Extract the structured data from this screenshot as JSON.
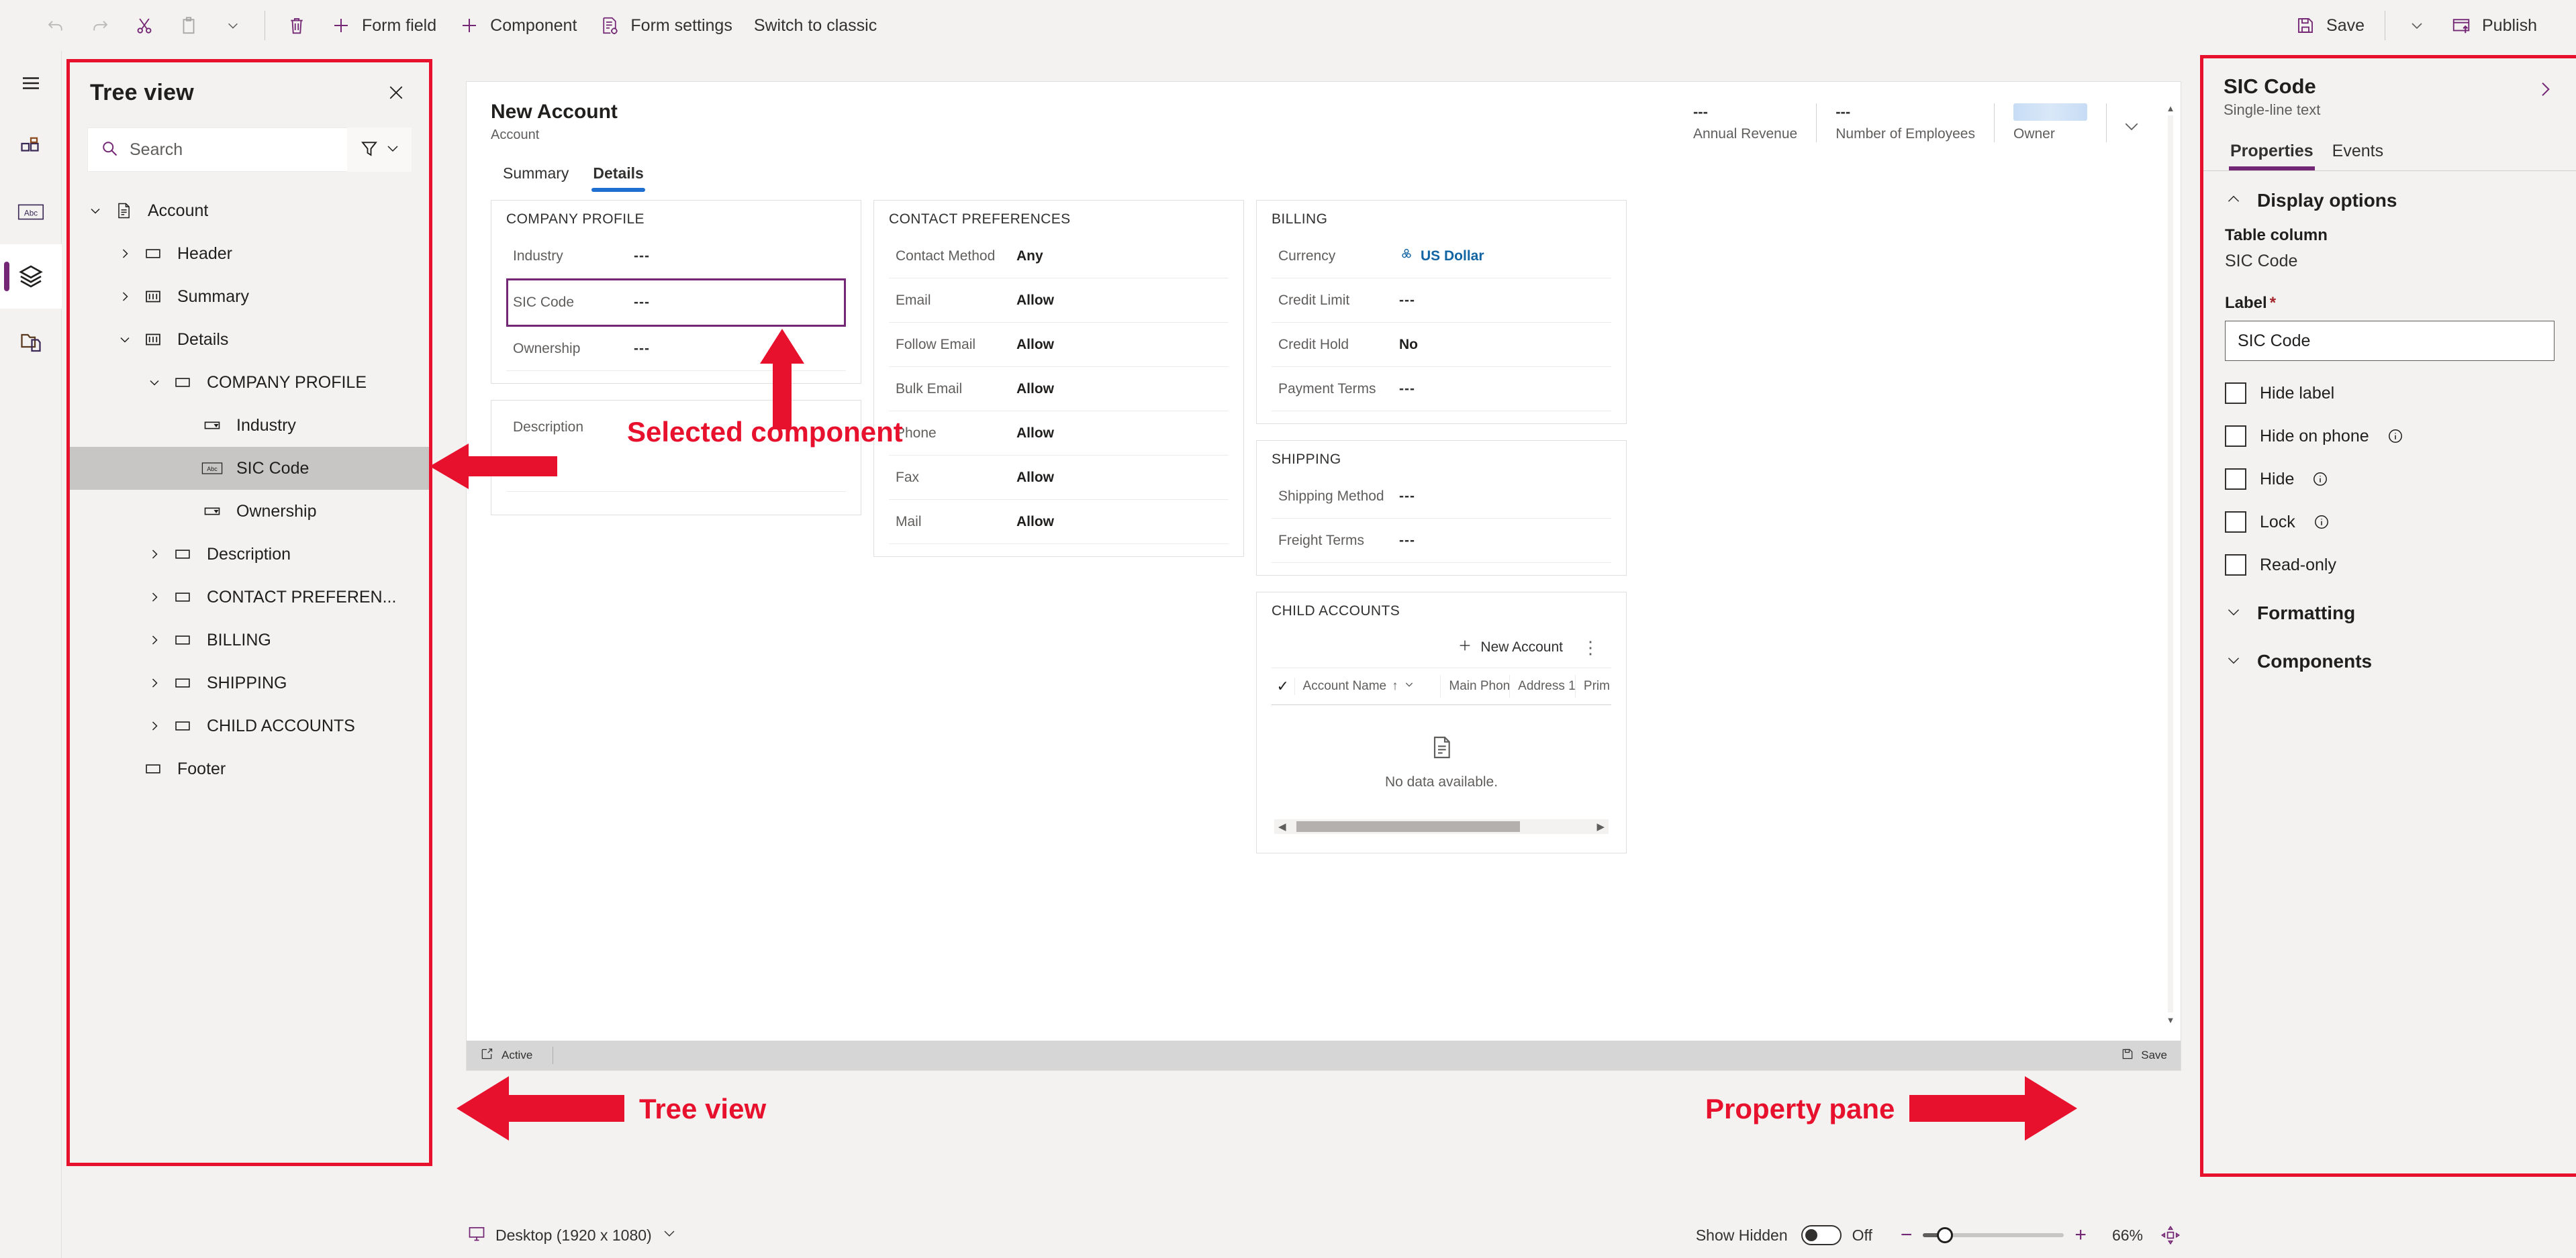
{
  "command_bar": {
    "left_buttons": [
      {
        "label": "",
        "icon": "undo-icon",
        "disabled": true
      },
      {
        "label": "",
        "icon": "redo-icon",
        "disabled": true
      },
      {
        "label": "",
        "icon": "cut-icon",
        "disabled": false
      },
      {
        "label": "",
        "icon": "paste-icon",
        "disabled": false
      },
      {
        "label": "",
        "icon": "chevron-down-icon",
        "disabled": false
      },
      {
        "label": "",
        "icon": "delete-icon",
        "disabled": false
      },
      {
        "label": "Form field",
        "icon": "plus-icon",
        "disabled": false
      },
      {
        "label": "Component",
        "icon": "plus-icon",
        "disabled": false
      },
      {
        "label": "Form settings",
        "icon": "form-settings-icon",
        "disabled": false
      },
      {
        "label": "Switch to classic",
        "icon": "",
        "disabled": false
      }
    ],
    "save_label": "Save",
    "publish_label": "Publish"
  },
  "rail": {
    "items": [
      {
        "name": "hamburger-menu-icon"
      },
      {
        "name": "components-icon"
      },
      {
        "name": "table-columns-icon"
      },
      {
        "name": "layers-icon"
      },
      {
        "name": "related-forms-icon"
      }
    ]
  },
  "tree_view": {
    "title": "Tree view",
    "search_placeholder": "Search",
    "search_value": "",
    "nodes": [
      {
        "label": "Account",
        "indent": 0,
        "chevron": "down",
        "icon": "document-icon",
        "selected": false
      },
      {
        "label": "Header",
        "indent": 1,
        "chevron": "right",
        "icon": "section-icon",
        "selected": false
      },
      {
        "label": "Summary",
        "indent": 1,
        "chevron": "right",
        "icon": "tab-icon",
        "selected": false
      },
      {
        "label": "Details",
        "indent": 1,
        "chevron": "down",
        "icon": "tab-icon",
        "selected": false
      },
      {
        "label": "COMPANY PROFILE",
        "indent": 2,
        "chevron": "down",
        "icon": "section-icon",
        "selected": false
      },
      {
        "label": "Industry",
        "indent": 3,
        "chevron": "none",
        "icon": "choice-icon",
        "selected": false
      },
      {
        "label": "SIC Code",
        "indent": 3,
        "chevron": "none",
        "icon": "text-abc-icon",
        "selected": true
      },
      {
        "label": "Ownership",
        "indent": 3,
        "chevron": "none",
        "icon": "choice-icon",
        "selected": false
      },
      {
        "label": "Description",
        "indent": 2,
        "chevron": "right",
        "icon": "section-icon",
        "selected": false
      },
      {
        "label": "CONTACT PREFEREN...",
        "indent": 2,
        "chevron": "right",
        "icon": "section-icon",
        "selected": false
      },
      {
        "label": "BILLING",
        "indent": 2,
        "chevron": "right",
        "icon": "section-icon",
        "selected": false
      },
      {
        "label": "SHIPPING",
        "indent": 2,
        "chevron": "right",
        "icon": "section-icon",
        "selected": false
      },
      {
        "label": "CHILD ACCOUNTS",
        "indent": 2,
        "chevron": "right",
        "icon": "section-icon",
        "selected": false
      },
      {
        "label": "Footer",
        "indent": 1,
        "chevron": "none",
        "icon": "section-icon",
        "selected": false
      }
    ]
  },
  "form": {
    "title": "New Account",
    "subtitle": "Account",
    "header_fields": [
      {
        "value": "---",
        "label": "Annual Revenue"
      },
      {
        "value": "---",
        "label": "Number of Employees"
      },
      {
        "value": "",
        "label": "Owner"
      }
    ],
    "tabs": [
      {
        "label": "Summary",
        "active": false
      },
      {
        "label": "Details",
        "active": true
      }
    ],
    "sections": {
      "company_profile": {
        "title": "COMPANY PROFILE",
        "rows": [
          {
            "label": "Industry",
            "value": "---",
            "selected": false
          },
          {
            "label": "SIC Code",
            "value": "---",
            "selected": true
          },
          {
            "label": "Ownership",
            "value": "---",
            "selected": false
          }
        ]
      },
      "description": {
        "label": "Description",
        "value": ""
      },
      "contact_preferences": {
        "title": "CONTACT PREFERENCES",
        "rows": [
          {
            "label": "Contact Method",
            "value": "Any"
          },
          {
            "label": "Email",
            "value": "Allow"
          },
          {
            "label": "Follow Email",
            "value": "Allow"
          },
          {
            "label": "Bulk Email",
            "value": "Allow"
          },
          {
            "label": "Phone",
            "value": "Allow"
          },
          {
            "label": "Fax",
            "value": "Allow"
          },
          {
            "label": "Mail",
            "value": "Allow"
          }
        ]
      },
      "billing": {
        "title": "BILLING",
        "rows": [
          {
            "label": "Currency",
            "value": "US Dollar",
            "link": true
          },
          {
            "label": "Credit Limit",
            "value": "---",
            "link": false
          },
          {
            "label": "Credit Hold",
            "value": "No",
            "link": false
          },
          {
            "label": "Payment Terms",
            "value": "---",
            "link": false
          }
        ]
      },
      "shipping": {
        "title": "SHIPPING",
        "rows": [
          {
            "label": "Shipping Method",
            "value": "---"
          },
          {
            "label": "Freight Terms",
            "value": "---"
          }
        ]
      },
      "child_accounts": {
        "title": "CHILD ACCOUNTS",
        "new_button": "New Account",
        "columns": [
          "Account Name",
          "Main Phone",
          "Address 1: ...",
          "Prim"
        ],
        "empty_text": "No data available."
      }
    },
    "footer": {
      "status": "Active",
      "save_label": "Save"
    }
  },
  "property_pane": {
    "title": "SIC Code",
    "subtitle": "Single-line text",
    "tabs": [
      {
        "label": "Properties",
        "active": true
      },
      {
        "label": "Events",
        "active": false
      }
    ],
    "groups": [
      {
        "label": "Display options",
        "expanded": true
      },
      {
        "label": "Formatting",
        "expanded": false
      },
      {
        "label": "Components",
        "expanded": false
      }
    ],
    "table_column_label": "Table column",
    "table_column_value": "SIC Code",
    "label_field_label": "Label",
    "label_field_value": "SIC Code",
    "checkboxes": [
      {
        "label": "Hide label",
        "checked": false,
        "info": false
      },
      {
        "label": "Hide on phone",
        "checked": false,
        "info": true
      },
      {
        "label": "Hide",
        "checked": false,
        "info": true
      },
      {
        "label": "Lock",
        "checked": false,
        "info": true
      },
      {
        "label": "Read-only",
        "checked": false,
        "info": false
      }
    ]
  },
  "bottom_bar": {
    "device_label": "Desktop (1920 x 1080)",
    "show_hidden_label": "Show Hidden",
    "show_hidden_state": "Off",
    "zoom_percent": "66%"
  },
  "annotations": [
    {
      "text": "Selected component"
    },
    {
      "text": "Tree view"
    },
    {
      "text": "Property pane"
    }
  ],
  "colors": {
    "accent_purple": "#742774",
    "annotation_red": "#e8112d",
    "tab_blue": "#1f6fd0",
    "link_blue": "#1264a3"
  }
}
